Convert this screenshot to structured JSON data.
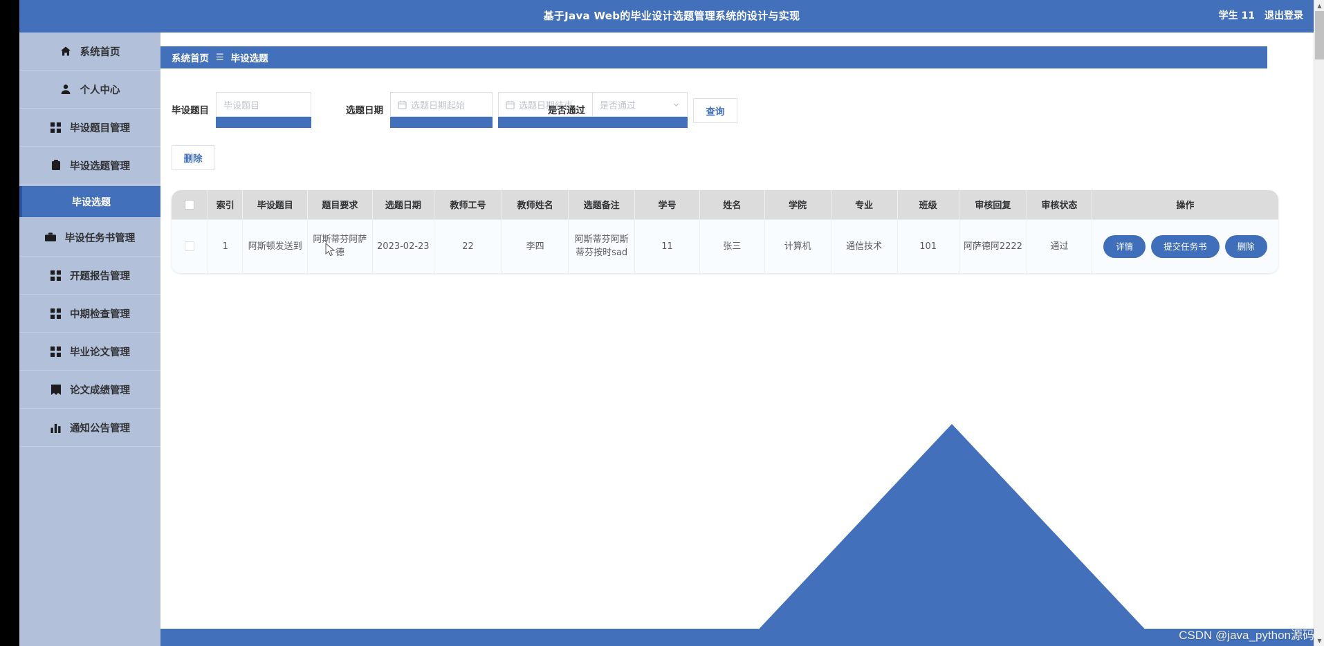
{
  "header": {
    "title": "基于Java Web的毕业设计选题管理系统的设计与实现",
    "user": "学生 11",
    "logout": "退出登录"
  },
  "sidebar": {
    "items": [
      {
        "label": "系统首页",
        "icon": "home-icon"
      },
      {
        "label": "个人中心",
        "icon": "user-icon"
      },
      {
        "label": "毕设题目管理",
        "icon": "grid-icon"
      },
      {
        "label": "毕设选题管理",
        "icon": "clipboard-icon"
      }
    ],
    "active_sub": "毕设选题",
    "items_after": [
      {
        "label": "毕设任务书管理",
        "icon": "briefcase-icon"
      },
      {
        "label": "开题报告管理",
        "icon": "grid-icon"
      },
      {
        "label": "中期检查管理",
        "icon": "grid-icon"
      },
      {
        "label": "毕业论文管理",
        "icon": "grid-icon"
      },
      {
        "label": "论文成绩管理",
        "icon": "book-icon"
      },
      {
        "label": "通知公告管理",
        "icon": "bar-chart-icon"
      }
    ]
  },
  "breadcrumb": {
    "home": "系统首页",
    "separator": "☰",
    "current": "毕设选题"
  },
  "filter": {
    "title_label": "毕设题目",
    "title_placeholder": "毕设题目",
    "title_value": "",
    "date_label": "选题日期",
    "date_start_placeholder": "选题日期起始",
    "date_start_value": "",
    "date_end_placeholder": "选题日期结束",
    "date_end_value": "",
    "pass_label": "是否通过",
    "pass_placeholder": "是否通过",
    "pass_value": "",
    "query_button": "查询"
  },
  "toolbar": {
    "delete_button": "删除"
  },
  "table": {
    "columns": [
      "索引",
      "毕设题目",
      "题目要求",
      "选题日期",
      "教师工号",
      "教师姓名",
      "选题备注",
      "学号",
      "姓名",
      "学院",
      "专业",
      "班级",
      "审核回复",
      "审核状态",
      "操作"
    ],
    "rows": [
      {
        "index": "1",
        "title": "阿斯顿发送到",
        "requirement": "阿斯蒂芬阿萨德",
        "date": "2023-02-23",
        "teacher_id": "22",
        "teacher_name": "李四",
        "remark": "阿斯蒂芬阿斯蒂芬按时sad",
        "student_id": "11",
        "student_name": "张三",
        "college": "计算机",
        "major": "通信技术",
        "class": "101",
        "review_reply": "阿萨德阿2222",
        "review_status": "通过",
        "ops": [
          "详情",
          "提交任务书",
          "删除"
        ]
      }
    ]
  },
  "watermark": "CSDN @java_python源码",
  "colors": {
    "brand_blue": "#4270ba",
    "sidebar_bg": "#b3c0da",
    "active_blue": "#4270ba",
    "header_row": "#dcdcdc",
    "row_bg": "#f8fcff"
  }
}
